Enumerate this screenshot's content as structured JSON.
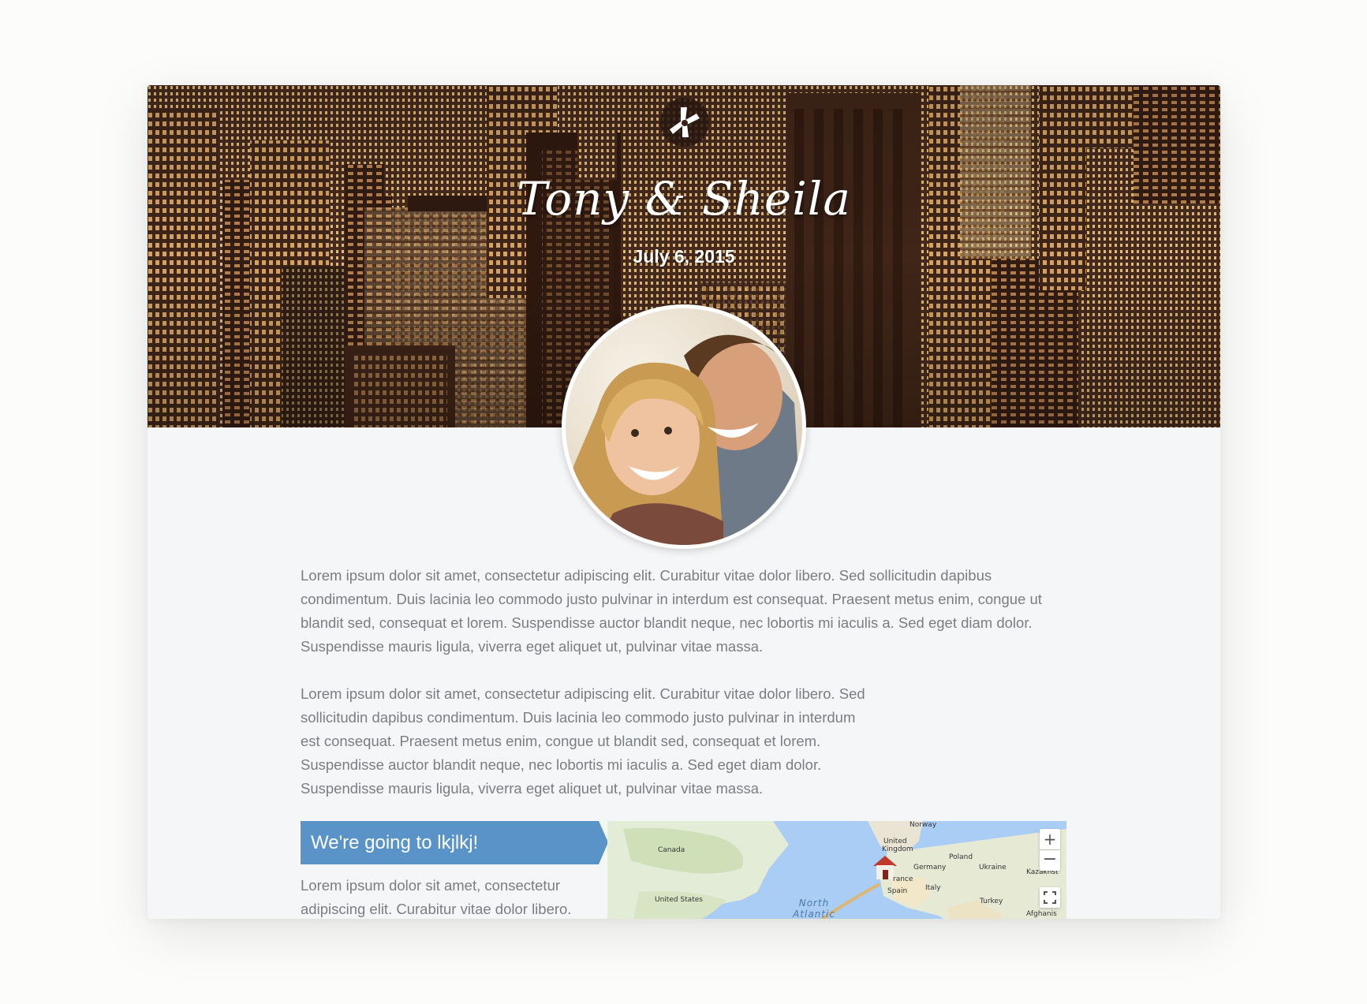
{
  "header": {
    "couple_names": "Tony & Sheila",
    "date": "July 6, 2015"
  },
  "story": {
    "paragraph_1": "Lorem ipsum dolor sit amet, consectetur adipiscing elit. Curabitur vitae dolor libero. Sed sollicitudin dapibus condimentum. Duis lacinia leo commodo justo pulvinar in interdum est consequat. Praesent metus enim, congue ut blandit sed, consequat et lorem. Suspendisse auctor blandit neque, nec lobortis mi iaculis a. Sed eget diam dolor. Suspendisse mauris ligula, viverra eget aliquet ut, pulvinar vitae massa.",
    "paragraph_2": "Lorem ipsum dolor sit amet, consectetur adipiscing elit. Curabitur vitae dolor libero. Sed sollicitudin dapibus condimentum. Duis lacinia leo commodo justo pulvinar in interdum est consequat. Praesent metus enim, congue ut blandit sed, consequat et lorem. Suspendisse auctor blandit neque, nec lobortis mi iaculis a. Sed eget diam dolor. Suspendisse mauris ligula, viverra eget aliquet ut, pulvinar vitae massa."
  },
  "destination": {
    "banner_text": "We're going to lkjlkj!",
    "paragraph": "Lorem ipsum dolor sit amet, consectetur adipiscing elit. Curabitur vitae dolor libero."
  },
  "map": {
    "zoom_in": "+",
    "zoom_out": "−",
    "labels": {
      "norway": "Norway",
      "united_kingdom_1": "United",
      "united_kingdom_2": "Kingdom",
      "canada": "Canada",
      "poland": "Poland",
      "germany": "Germany",
      "ukraine": "Ukraine",
      "kazakhstan": "Kazakhst",
      "france": "rance",
      "italy": "Italy",
      "spain": "Spain",
      "united_states": "United States",
      "turkey": "Turkey",
      "afghanistan": "Afghanis",
      "ocean_1": "North",
      "ocean_2": "Atlantic"
    },
    "icons": {
      "marker": "house-marker-icon",
      "fullscreen": "fullscreen-icon"
    }
  },
  "colors": {
    "banner": "#5a93c7",
    "body_text": "#7a7d82",
    "card_background": "#f5f6f7",
    "page_background": "#fcfcfb"
  },
  "icons": {
    "logo": "wedding-logo-icon"
  }
}
